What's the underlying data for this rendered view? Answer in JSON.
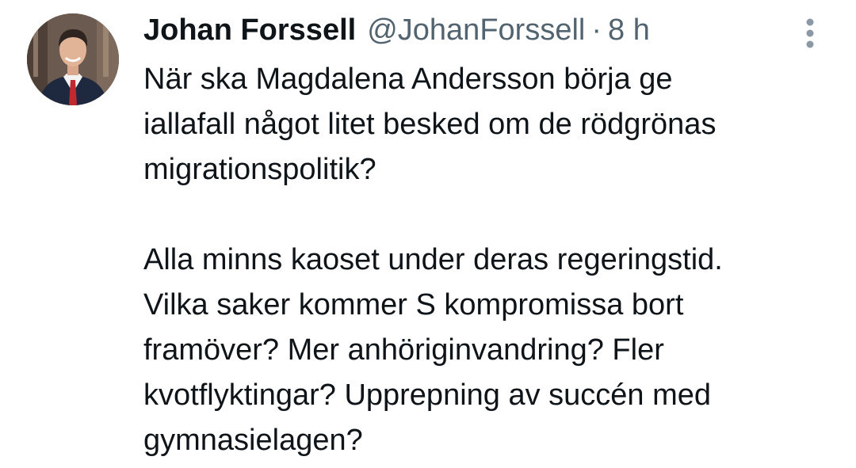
{
  "tweet": {
    "author": {
      "display_name": "Johan Forssell",
      "handle": "@JohanForssell",
      "separator": "·",
      "time": "8 h",
      "avatar_icon": "profile-photo"
    },
    "more_icon": "more-vertical-icon",
    "lines": [
      "När ska Magdalena Andersson börja ge",
      "iallafall något litet besked om de rödgrönas",
      "migrationspolitik?",
      "",
      "Alla minns kaoset under deras regeringstid.",
      "Vilka saker kommer S kompromissa bort",
      "framöver? Mer anhöriginvandring? Fler",
      "kvotflyktingar? Upprepning av succén med",
      "gymnasielagen?"
    ]
  }
}
